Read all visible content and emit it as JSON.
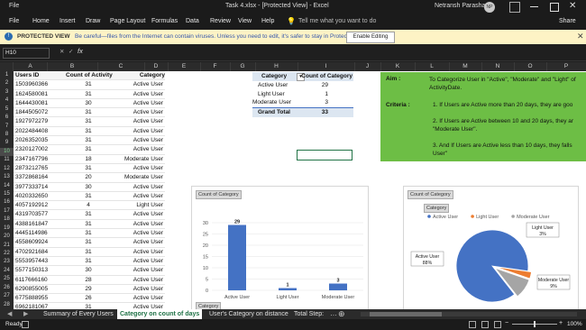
{
  "titlebar": {
    "autosave": "File",
    "file_title": "Task 4.xlsx - [Protected View] - Excel",
    "user": "Netransh Parashar",
    "user_initials": "NP"
  },
  "menu": [
    "Home",
    "Insert",
    "Draw",
    "Page Layout",
    "Formulas",
    "Data",
    "Review",
    "View",
    "Help"
  ],
  "tell_me": "Tell me what you want to do",
  "share_label": "Share",
  "protected": {
    "label": "PROTECTED VIEW",
    "message": "Be careful—files from the Internet can contain viruses. Unless you need to edit, it's safer to stay in Protected View.",
    "button": "Enable Editing"
  },
  "formula_bar": {
    "name_box": "H10",
    "fx": "fx",
    "value": ""
  },
  "columns": [
    "A",
    "B",
    "C",
    "D",
    "E",
    "F",
    "G",
    "H",
    "I",
    "J",
    "K",
    "L",
    "M",
    "N",
    "O",
    "P"
  ],
  "rows": [
    "1",
    "2",
    "3",
    "4",
    "5",
    "6",
    "7",
    "8",
    "9",
    "10",
    "11",
    "12",
    "13",
    "14",
    "15",
    "16",
    "17",
    "18",
    "19",
    "20",
    "21",
    "22",
    "23",
    "24",
    "25",
    "26",
    "27",
    "28"
  ],
  "table": {
    "headers": [
      "Users ID",
      "Count of ActivityDate",
      "Category"
    ],
    "data": [
      [
        "1503960366",
        "31",
        "Active User"
      ],
      [
        "1624580081",
        "31",
        "Active User"
      ],
      [
        "1644430081",
        "30",
        "Active User"
      ],
      [
        "1844505072",
        "31",
        "Active User"
      ],
      [
        "1927972279",
        "31",
        "Active User"
      ],
      [
        "2022484408",
        "31",
        "Active User"
      ],
      [
        "2026352035",
        "31",
        "Active User"
      ],
      [
        "2320127002",
        "31",
        "Active User"
      ],
      [
        "2347167796",
        "18",
        "Moderate User"
      ],
      [
        "2873212765",
        "31",
        "Active User"
      ],
      [
        "3372868164",
        "20",
        "Moderate User"
      ],
      [
        "3977333714",
        "30",
        "Active User"
      ],
      [
        "4020332650",
        "31",
        "Active User"
      ],
      [
        "4057192912",
        "4",
        "Light User"
      ],
      [
        "4319703577",
        "31",
        "Active User"
      ],
      [
        "4388161847",
        "31",
        "Active User"
      ],
      [
        "4445114986",
        "31",
        "Active User"
      ],
      [
        "4558609924",
        "31",
        "Active User"
      ],
      [
        "4702921684",
        "31",
        "Active User"
      ],
      [
        "5553957443",
        "31",
        "Active User"
      ],
      [
        "5577150313",
        "30",
        "Active User"
      ],
      [
        "6117666160",
        "28",
        "Active User"
      ],
      [
        "6290855005",
        "29",
        "Active User"
      ],
      [
        "6775888955",
        "26",
        "Active User"
      ],
      [
        "6962181067",
        "31",
        "Active User"
      ],
      [
        "7007744171",
        "26",
        "Active User"
      ]
    ]
  },
  "pivot": {
    "headers": [
      "Category",
      "Count of Category"
    ],
    "rows": [
      [
        "Active User",
        "29"
      ],
      [
        "Light User",
        "1"
      ],
      [
        "Moderate User",
        "3"
      ]
    ],
    "total": [
      "Grand Total",
      "33"
    ]
  },
  "aim": {
    "aim_label": "Aim :",
    "aim_text": "To Categorize User in \"Active\", \"Moderate\" and \"Light\" of ActivityDate.",
    "criteria_label": "Criteria :",
    "points": [
      "1. If Users are Active more than 20 days, they are goo",
      "2. If Users are Active between 10 and 20 days, they ar \"Moderate User\".",
      "3. And If Users are Active less than 10 days, they falls User\""
    ]
  },
  "bar_chart_ui": {
    "title_chip": "Count of Category",
    "filter_chip": "Category"
  },
  "pie_chart_ui": {
    "title_chip": "Count of Category",
    "filter_chip": "Category"
  },
  "chart_data": [
    {
      "type": "bar",
      "categories": [
        "Active User",
        "Light User",
        "Moderate User"
      ],
      "values": [
        29,
        1,
        3
      ],
      "ylim": [
        0,
        30
      ],
      "yticks": [
        0,
        5,
        10,
        15,
        20,
        25,
        30
      ],
      "grid": true,
      "colors": [
        "#4472c4"
      ]
    },
    {
      "type": "pie",
      "categories": [
        "Active User",
        "Light User",
        "Moderate User"
      ],
      "values": [
        29,
        1,
        3
      ],
      "percent_labels": [
        "88%",
        "3%",
        "9%"
      ],
      "colors": [
        "#4472c4",
        "#ed7d31",
        "#a5a5a5"
      ],
      "legend": "top"
    }
  ],
  "sheet_tabs": [
    "Summary of Every Users",
    "Category on count of days",
    "User's Category on distance",
    "Total Step:"
  ],
  "active_tab": "Category on count of days",
  "status": {
    "ready": "Ready",
    "zoom": "100%"
  }
}
